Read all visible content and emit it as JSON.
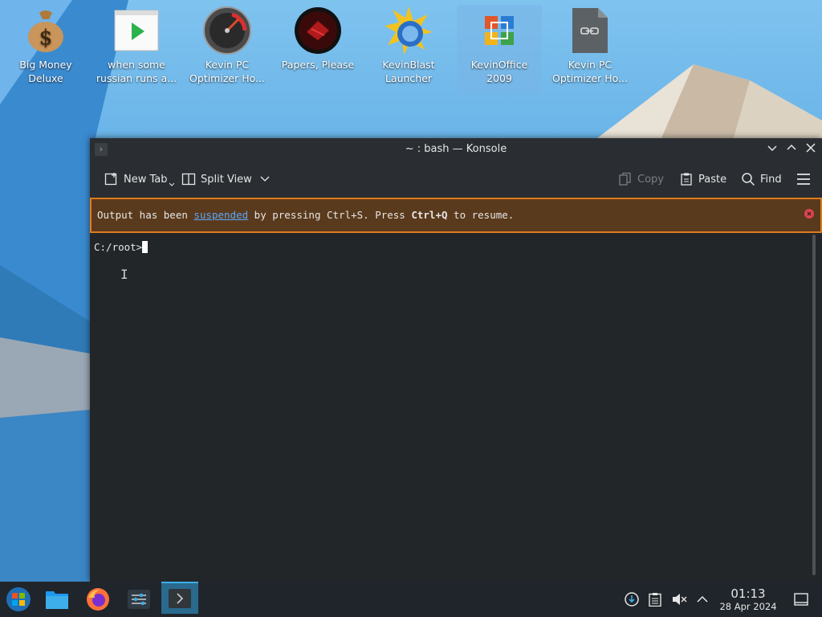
{
  "desktop": {
    "icons": [
      {
        "label": "Big Money Deluxe",
        "icon": "money-bag-icon"
      },
      {
        "label": "when some russian runs a...",
        "icon": "video-file-icon"
      },
      {
        "label": "Kevin PC Optimizer Ho...",
        "icon": "speedometer-icon"
      },
      {
        "label": "Papers, Please",
        "icon": "papers-please-icon"
      },
      {
        "label": "KevinBlast Launcher",
        "icon": "sunburst-launcher-icon"
      },
      {
        "label": "KevinOffice 2009",
        "icon": "office-logo-icon"
      },
      {
        "label": "Kevin PC Optimizer Ho...",
        "icon": "link-file-icon"
      }
    ]
  },
  "window": {
    "title": "~ : bash — Konsole",
    "toolbar": {
      "new_tab": "New Tab",
      "split_view": "Split View",
      "copy": "Copy",
      "paste": "Paste",
      "find": "Find"
    },
    "banner": {
      "pre": "Output has been ",
      "link": "suspended",
      "mid": " by pressing Ctrl+S. Press ",
      "key": "Ctrl+Q",
      "post": " to resume."
    },
    "terminal": {
      "prompt": "C:/root>"
    }
  },
  "taskbar": {
    "clock": {
      "time": "01:13",
      "date": "28 Apr 2024"
    },
    "apps": [
      "start-menu-icon",
      "file-manager-icon",
      "firefox-icon",
      "settings-icon",
      "konsole-icon"
    ]
  },
  "colors": {
    "accent": "#3daee9",
    "banner_border": "#e07b1e",
    "banner_bg": "#5a3a1c"
  }
}
